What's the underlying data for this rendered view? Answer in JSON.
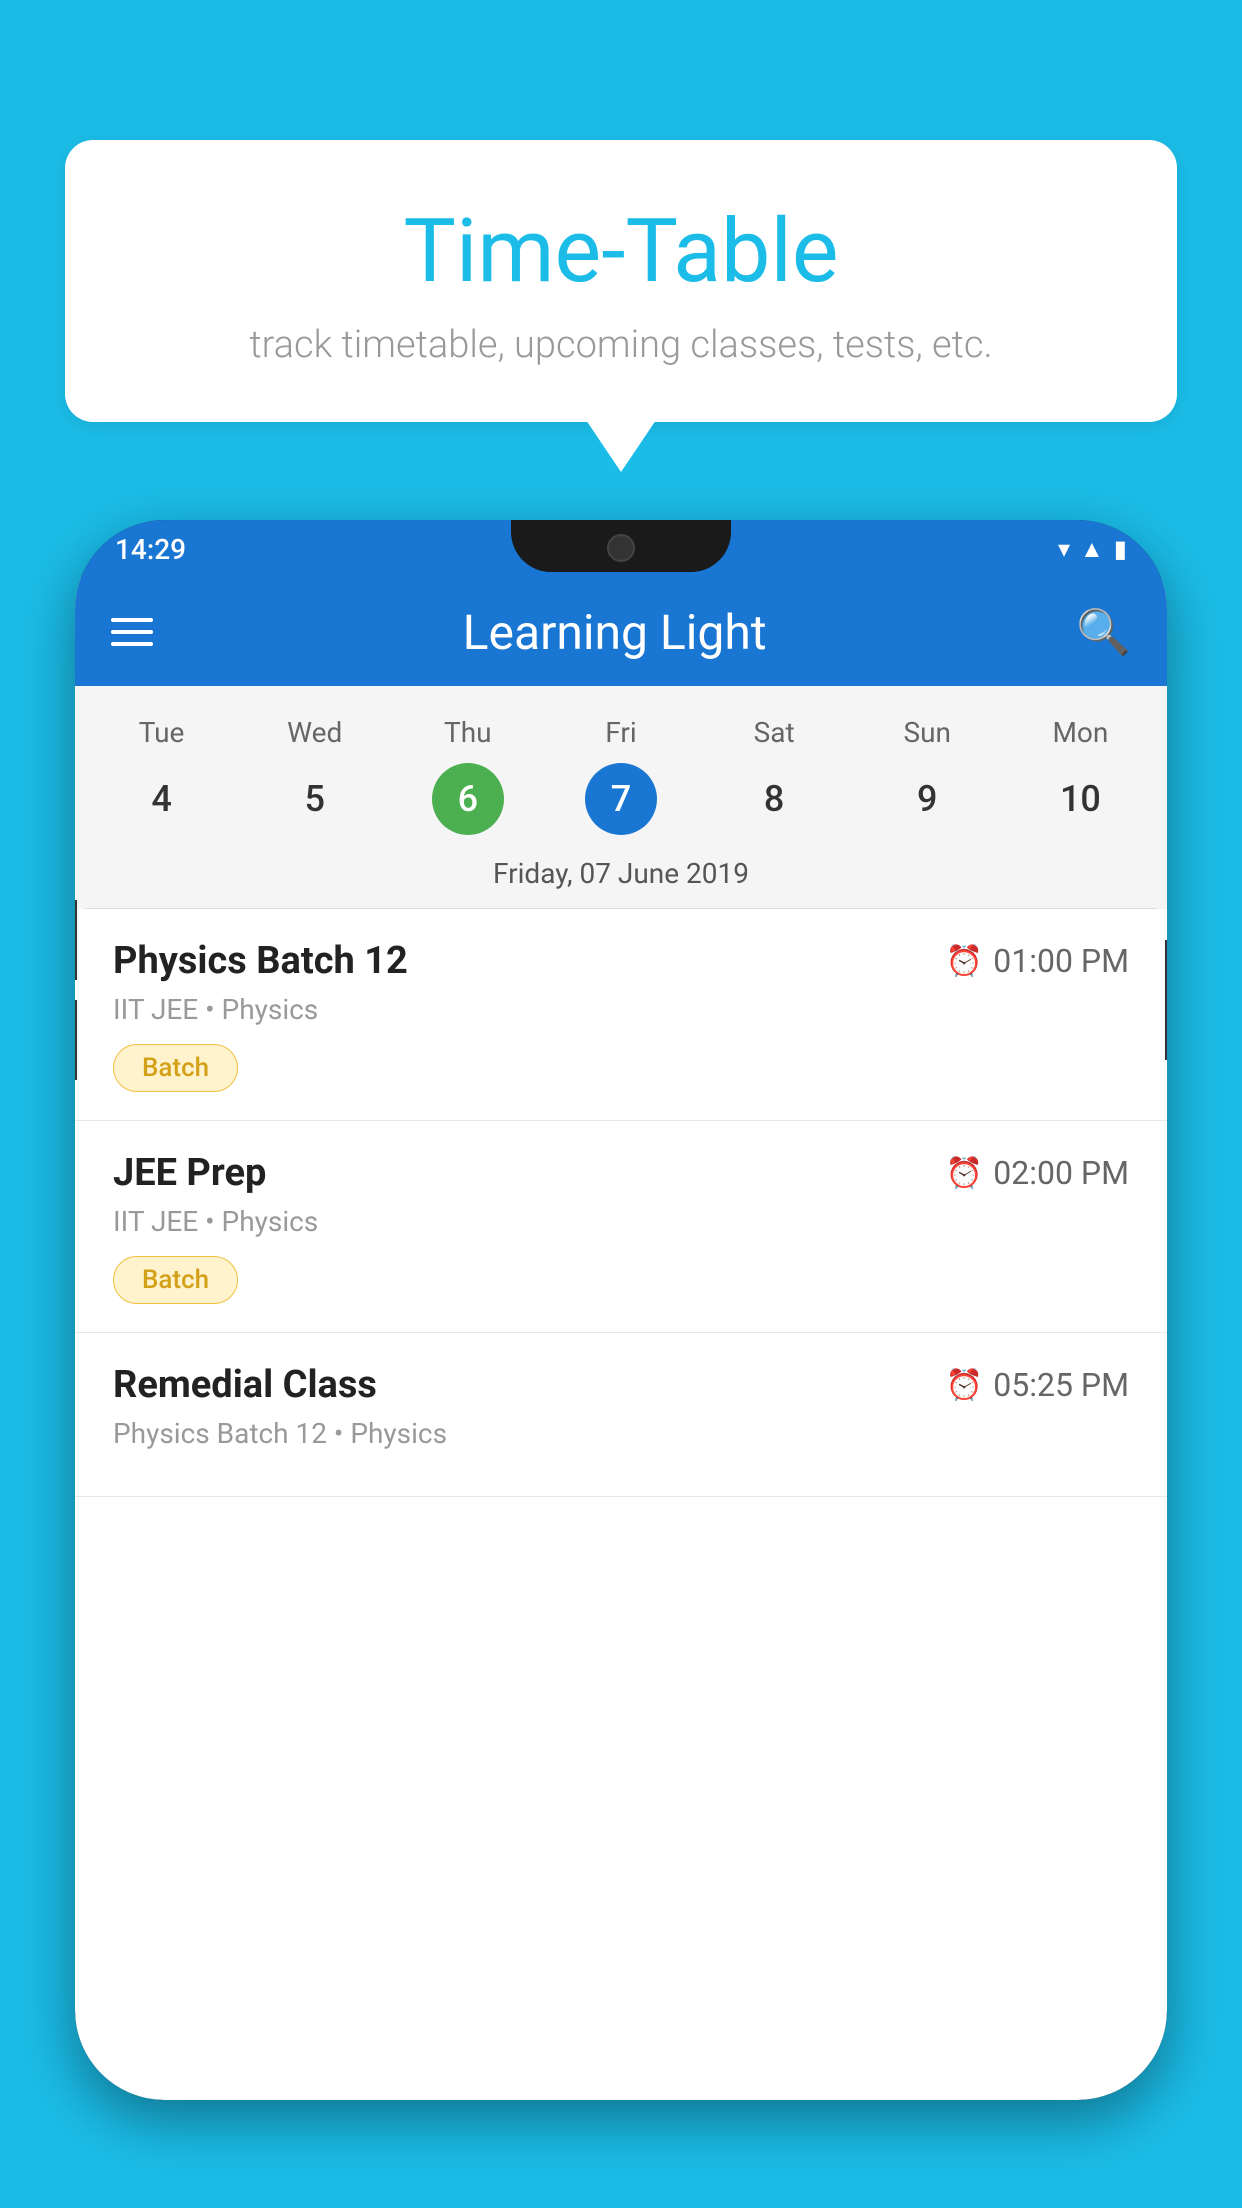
{
  "background": {
    "color": "#1BBDE8"
  },
  "speech_bubble": {
    "title": "Time-Table",
    "subtitle": "track timetable, upcoming classes, tests, etc."
  },
  "app_bar": {
    "title": "Learning Light",
    "menu_icon_label": "menu",
    "search_icon_label": "search"
  },
  "status_bar": {
    "time": "14:29"
  },
  "calendar": {
    "days": [
      {
        "name": "Tue",
        "number": "4",
        "state": "normal"
      },
      {
        "name": "Wed",
        "number": "5",
        "state": "normal"
      },
      {
        "name": "Thu",
        "number": "6",
        "state": "today"
      },
      {
        "name": "Fri",
        "number": "7",
        "state": "selected"
      },
      {
        "name": "Sat",
        "number": "8",
        "state": "normal"
      },
      {
        "name": "Sun",
        "number": "9",
        "state": "normal"
      },
      {
        "name": "Mon",
        "number": "10",
        "state": "normal"
      }
    ],
    "selected_date_label": "Friday, 07 June 2019"
  },
  "classes": [
    {
      "name": "Physics Batch 12",
      "time": "01:00 PM",
      "meta": "IIT JEE • Physics",
      "badge": "Batch"
    },
    {
      "name": "JEE Prep",
      "time": "02:00 PM",
      "meta": "IIT JEE • Physics",
      "badge": "Batch"
    },
    {
      "name": "Remedial Class",
      "time": "05:25 PM",
      "meta": "Physics Batch 12 • Physics",
      "badge": null
    }
  ]
}
